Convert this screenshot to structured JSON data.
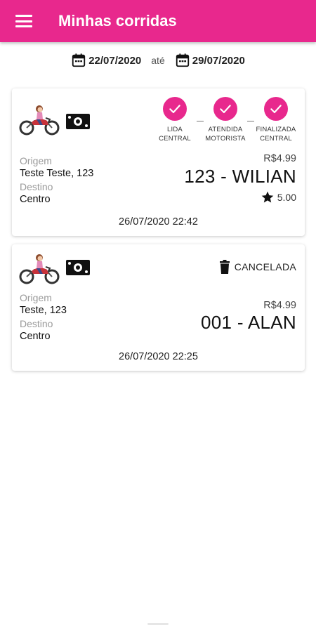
{
  "appbar": {
    "title": "Minhas corridas",
    "accent_color": "#e8288d",
    "menu_icon": "menu-icon"
  },
  "date_range": {
    "start": "22/07/2020",
    "separator": "até",
    "end": "29/07/2020",
    "icon": "calendar-icon"
  },
  "rides": [
    {
      "vehicle_icon": "motorcycle-icon",
      "payment_icon": "cash-icon",
      "steps": [
        {
          "label_line1": "LIDA",
          "label_line2": "CENTRAL",
          "icon": "check-icon"
        },
        {
          "label_line1": "ATENDIDA",
          "label_line2": "MOTORISTA",
          "icon": "check-icon"
        },
        {
          "label_line1": "FINALIZADA",
          "label_line2": "CENTRAL",
          "icon": "check-icon"
        }
      ],
      "origin_label": "Origem",
      "origin": "Teste Teste, 123",
      "destination_label": "Destino",
      "destination": "Centro",
      "price": "R$4.99",
      "driver": "123 - WILIAN",
      "rating": "5.00",
      "datetime": "26/07/2020 22:42"
    },
    {
      "vehicle_icon": "motorcycle-icon",
      "payment_icon": "cash-icon",
      "status": "CANCELADA",
      "status_icon": "trash-icon",
      "origin_label": "Origem",
      "origin": "Teste, 123",
      "destination_label": "Destino",
      "destination": "Centro",
      "price": "R$4.99",
      "driver": "001 - ALAN",
      "datetime": "26/07/2020 22:25"
    }
  ]
}
